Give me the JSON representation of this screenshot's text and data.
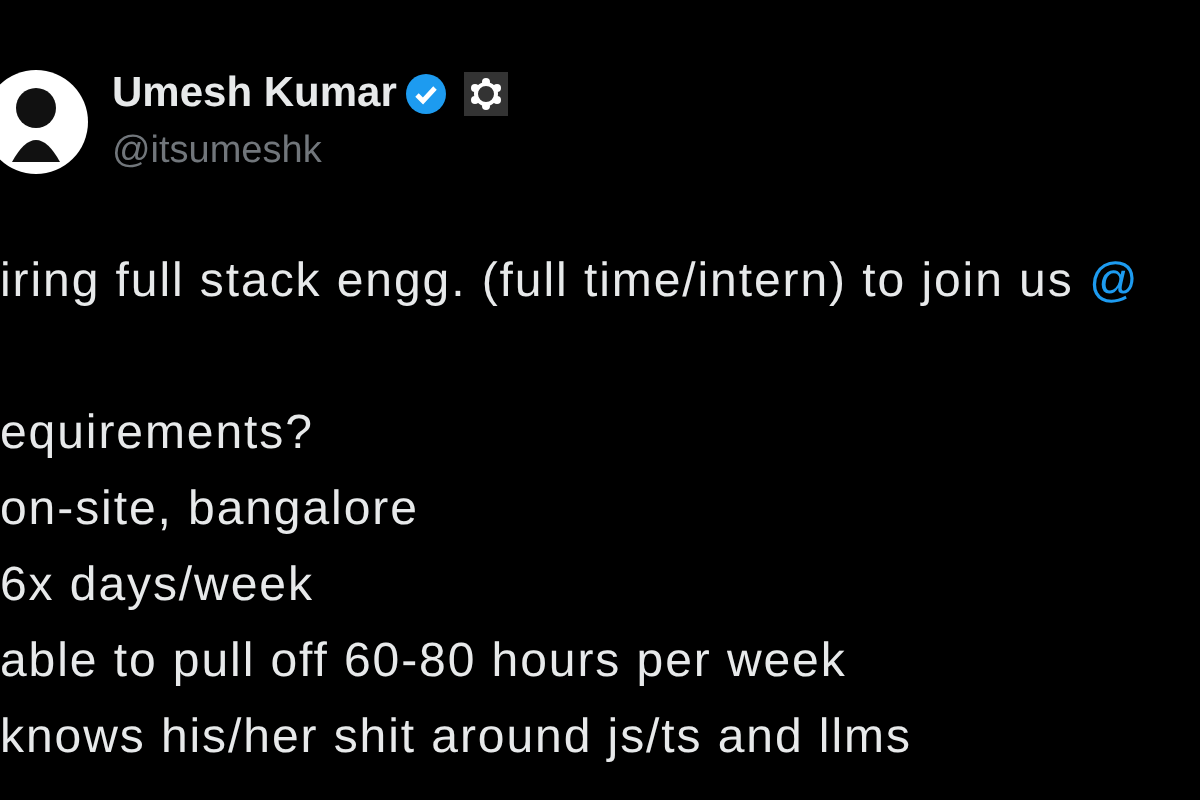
{
  "author": {
    "name": "Umesh Kumar",
    "verified": true,
    "handle": "@itsumeshk"
  },
  "post": {
    "lines": [
      {
        "kind": "text",
        "text": "iring full stack engg. (full time/intern) to join us ",
        "mention": "@"
      },
      {
        "kind": "blank"
      },
      {
        "kind": "text",
        "text": "equirements?"
      },
      {
        "kind": "text",
        "text": "on-site, bangalore"
      },
      {
        "kind": "text",
        "text": "6x days/week"
      },
      {
        "kind": "text",
        "text": "able to pull off 60-80 hours per week"
      },
      {
        "kind": "text",
        "text": "knows his/her shit around js/ts and llms"
      }
    ]
  }
}
